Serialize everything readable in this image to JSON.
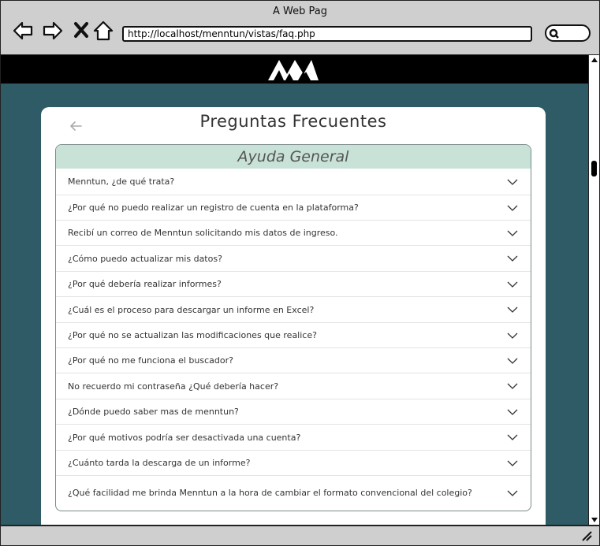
{
  "window": {
    "title": "A Web Pag"
  },
  "browser": {
    "url": "http://localhost/menntun/vistas/faq.php"
  },
  "page": {
    "title": "Preguntas Frecuentes",
    "section": "Ayuda General",
    "questions": [
      "Menntun, ¿de qué trata?",
      "¿Por qué no puedo realizar un registro de cuenta en la plataforma?",
      "Recibí un correo de Menntun solicitando mis datos de ingreso.",
      "¿Cómo puedo actualizar mis datos?",
      "¿Por qué debería realizar informes?",
      "¿Cuál es el proceso para descargar un informe en Excel?",
      "¿Por qué no se actualizan las modificaciones que realice?",
      "¿Por qué no me funciona el buscador?",
      "No recuerdo mi contraseña ¿Qué debería hacer?",
      "¿Dónde puedo saber mas de menntun?",
      "¿Por qué motivos podría ser desactivada una cuenta?",
      "¿Cuánto tarda la descarga de un informe?",
      "¿Qué facilidad me brinda Menntun a la hora de cambiar el formato convencional del colegio?"
    ]
  },
  "colors": {
    "page_bg": "#2e5b66",
    "section_header": "#c8e2d8",
    "appbar": "#000000"
  }
}
